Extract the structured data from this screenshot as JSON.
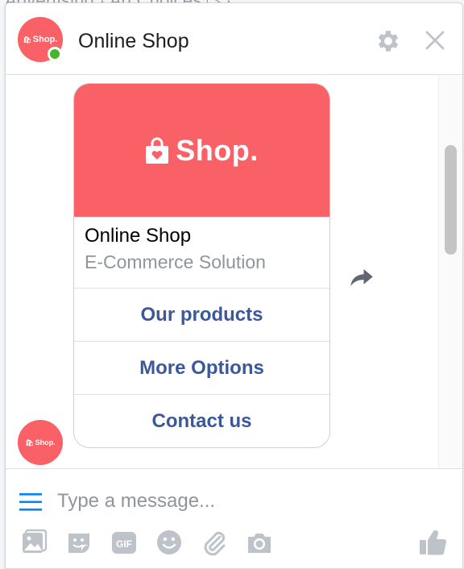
{
  "background": {
    "text": "Advertising · Ad Choices ▷ ·"
  },
  "chat": {
    "title": "Online Shop",
    "avatar_text": "Shop.",
    "status": "online"
  },
  "card": {
    "brand": "Shop.",
    "title": "Online Shop",
    "subtitle": "E-Commerce Solution",
    "buttons": [
      "Our products",
      "More Options",
      "Contact us"
    ]
  },
  "composer": {
    "placeholder": "Type a message...",
    "tools": [
      "photo-icon",
      "sticker-icon",
      "gif-icon",
      "emoji-icon",
      "attachment-icon",
      "camera-icon",
      "like-icon"
    ],
    "gif_label": "GIF"
  },
  "colors": {
    "brand": "#f96166",
    "online": "#42b72a",
    "link": "#3b5998",
    "messenger_blue": "#0084ff",
    "icon_gray": "#bec2c9"
  }
}
